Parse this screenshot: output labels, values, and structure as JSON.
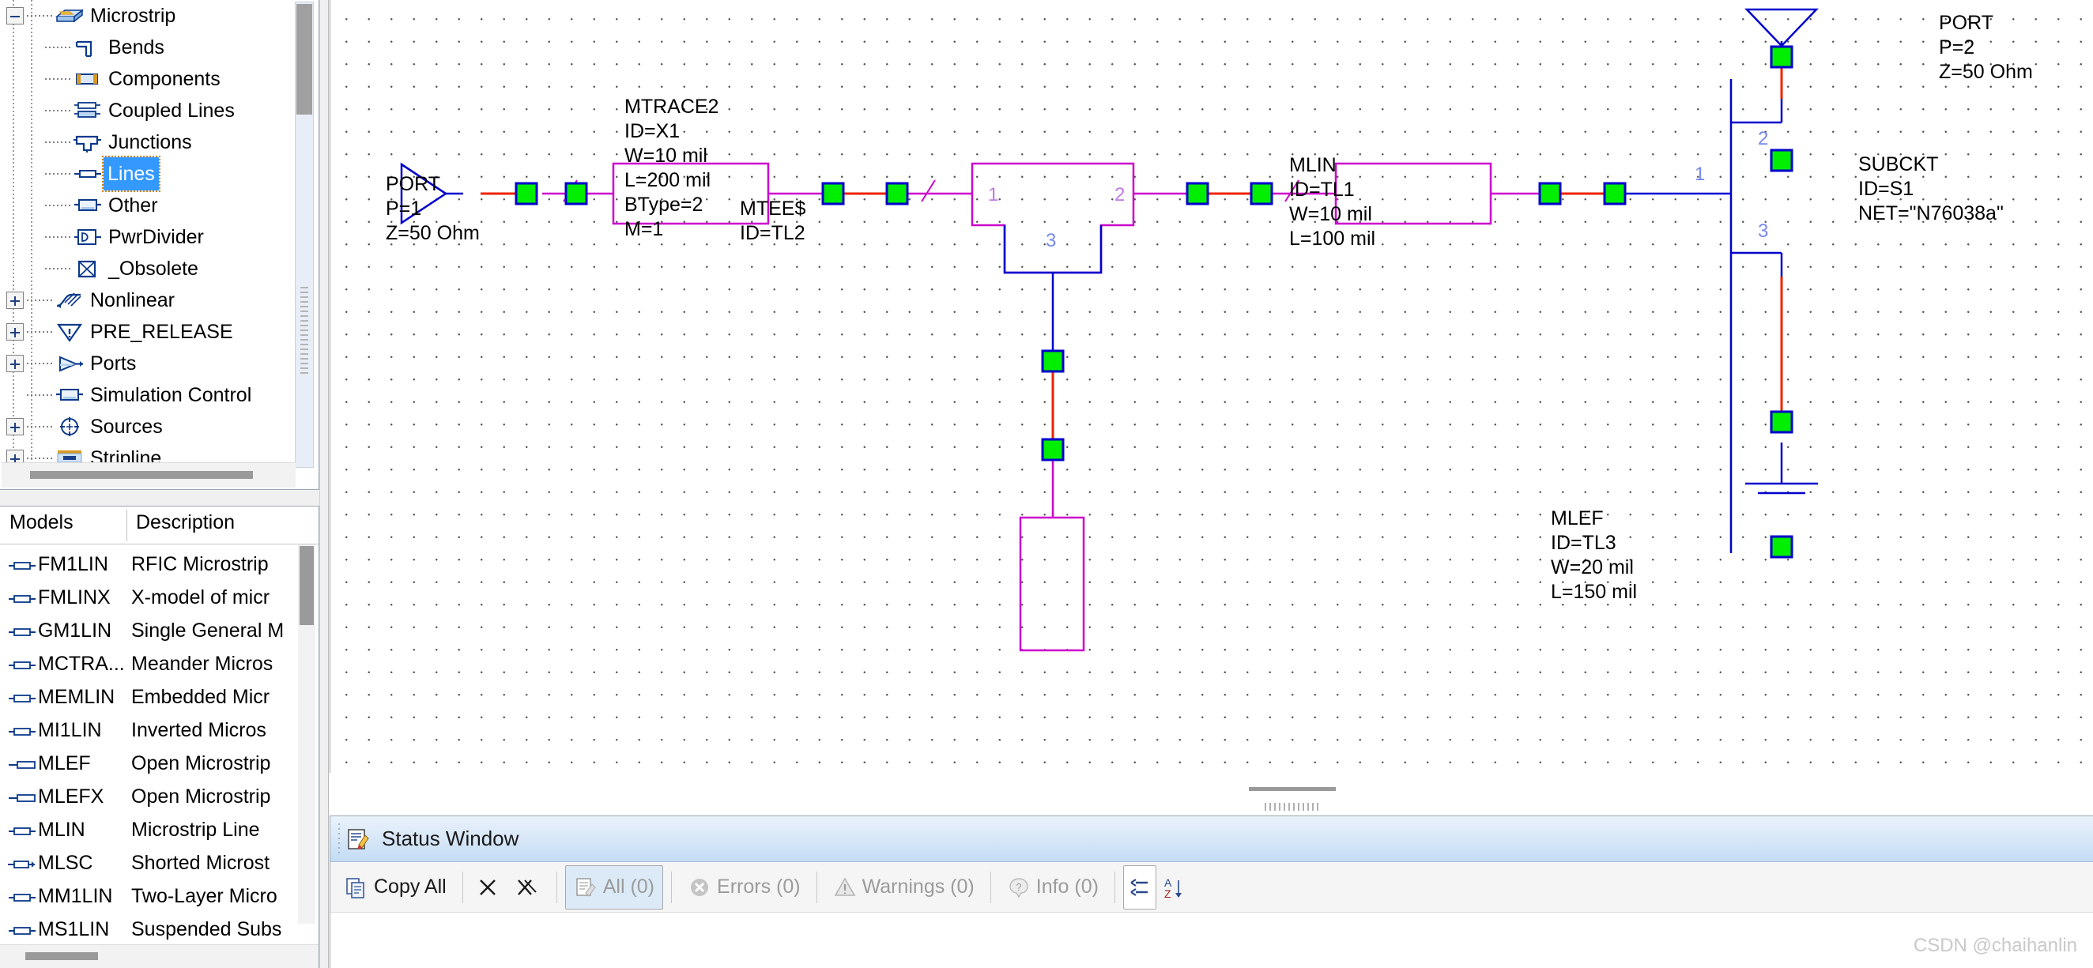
{
  "tree": {
    "items": [
      {
        "label": "Microstrip",
        "icon": "microstrip-icon",
        "indent": 0,
        "expander": "minus",
        "selected": false
      },
      {
        "label": "Bends",
        "icon": "bends-icon",
        "indent": 1,
        "expander": "none",
        "selected": false
      },
      {
        "label": "Components",
        "icon": "components-icon",
        "indent": 1,
        "expander": "none",
        "selected": false
      },
      {
        "label": "Coupled Lines",
        "icon": "coupled-lines-icon",
        "indent": 1,
        "expander": "none",
        "selected": false
      },
      {
        "label": "Junctions",
        "icon": "junctions-icon",
        "indent": 1,
        "expander": "none",
        "selected": false
      },
      {
        "label": "Lines",
        "icon": "lines-icon",
        "indent": 1,
        "expander": "none",
        "selected": true
      },
      {
        "label": "Other",
        "icon": "other-icon",
        "indent": 1,
        "expander": "none",
        "selected": false
      },
      {
        "label": "PwrDivider",
        "icon": "pwrdivider-icon",
        "indent": 1,
        "expander": "none",
        "selected": false
      },
      {
        "label": "_Obsolete",
        "icon": "obsolete-icon",
        "indent": 1,
        "expander": "none",
        "selected": false
      },
      {
        "label": "Nonlinear",
        "icon": "nonlinear-icon",
        "indent": 0,
        "expander": "plus",
        "selected": false
      },
      {
        "label": "PRE_RELEASE",
        "icon": "pre-release-icon",
        "indent": 0,
        "expander": "plus",
        "selected": false
      },
      {
        "label": "Ports",
        "icon": "ports-icon",
        "indent": 0,
        "expander": "plus",
        "selected": false
      },
      {
        "label": "Simulation Control",
        "icon": "simulation-control-icon",
        "indent": 0,
        "expander": "none",
        "selected": false
      },
      {
        "label": "Sources",
        "icon": "sources-icon",
        "indent": 0,
        "expander": "plus",
        "selected": false
      },
      {
        "label": "Stripline",
        "icon": "stripline-icon",
        "indent": 0,
        "expander": "plus",
        "selected": false
      }
    ]
  },
  "models": {
    "columns": [
      "Models",
      "Description"
    ],
    "rows": [
      {
        "name": "FM1LIN",
        "desc": "RFIC Microstrip",
        "icon": "line-icon"
      },
      {
        "name": "FMLINX",
        "desc": "X-model of micr",
        "icon": "line-icon"
      },
      {
        "name": "GM1LIN",
        "desc": "Single General M",
        "icon": "line-icon"
      },
      {
        "name": "MCTRA...",
        "desc": "Meander Micros",
        "icon": "line-icon"
      },
      {
        "name": "MEMLIN",
        "desc": "Embedded Micr",
        "icon": "line-icon"
      },
      {
        "name": "MI1LIN",
        "desc": "Inverted Micros",
        "icon": "line-icon"
      },
      {
        "name": "MLEF",
        "desc": "Open Microstrip",
        "icon": "open-line-icon"
      },
      {
        "name": "MLEFX",
        "desc": "Open Microstrip",
        "icon": "open-line-icon"
      },
      {
        "name": "MLIN",
        "desc": "Microstrip Line",
        "icon": "line-icon"
      },
      {
        "name": "MLSC",
        "desc": "Shorted Microst",
        "icon": "shorted-line-icon"
      },
      {
        "name": "MM1LIN",
        "desc": "Two-Layer Micro",
        "icon": "line-icon"
      },
      {
        "name": "MS1LIN",
        "desc": "Suspended Subs",
        "icon": "line-icon"
      }
    ]
  },
  "schematic": {
    "port1": {
      "lines": [
        "PORT",
        "P=1",
        "Z=50 Ohm"
      ]
    },
    "mtrace2": {
      "lines": [
        "MTRACE2",
        "ID=X1",
        "W=10 mil",
        "L=200 mil",
        "BType=2",
        "M=1"
      ]
    },
    "mtee": {
      "lines": [
        "MTEE$",
        "ID=TL2"
      ],
      "pins": [
        "1",
        "2",
        "3"
      ]
    },
    "mlin": {
      "lines": [
        "MLIN",
        "ID=TL1",
        "W=10 mil",
        "L=100 mil"
      ]
    },
    "mlef": {
      "lines": [
        "MLEF",
        "ID=TL3",
        "W=20 mil",
        "L=150 mil"
      ]
    },
    "subckt": {
      "lines": [
        "SUBCKT",
        "ID=S1",
        "NET=\"N76038a\""
      ],
      "pins": [
        "1",
        "2",
        "3"
      ]
    },
    "port2": {
      "lines": [
        "PORT",
        "P=2",
        "Z=50 Ohm"
      ]
    },
    "colors": {
      "wire_blue": "#0000cc",
      "wire_red": "#ee2200",
      "element_magenta": "#cc00cc",
      "node_green": "#00ee00",
      "node_border": "#0000cc",
      "pin_text": "#7755dd"
    }
  },
  "status": {
    "title": "Status Window",
    "toolbar": {
      "copy_all": "Copy All",
      "all": "All (0)",
      "errors": "Errors (0)",
      "warnings": "Warnings (0)",
      "info": "Info (0)"
    }
  },
  "watermark": "CSDN @chaihanlin"
}
